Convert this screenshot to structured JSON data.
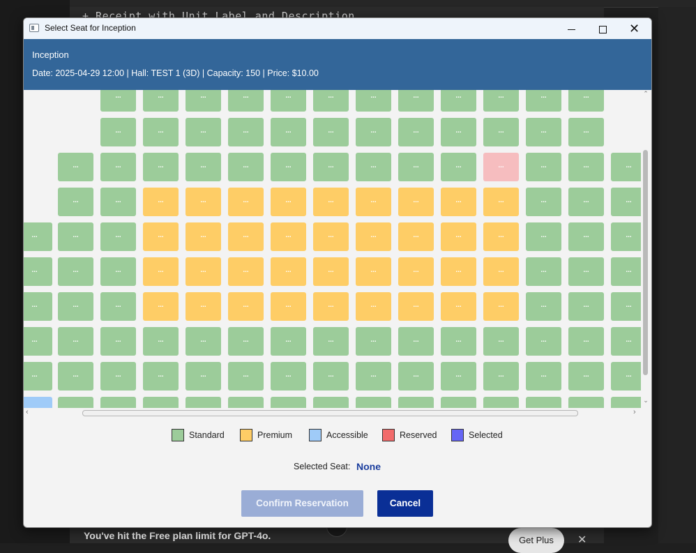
{
  "background": {
    "code_line": "+  Receipt  with  Unit  Label  and  Description",
    "limit_notice": "You've hit the Free plan limit for GPT-4o.",
    "upgrade_button": "Get Plus"
  },
  "window": {
    "title": "Select Seat for Inception",
    "minimize_icon": "minimize-icon",
    "maximize_icon": "maximize-icon",
    "close_icon": "close-icon"
  },
  "header": {
    "movie_title": "Inception",
    "info": "Date: 2025-04-29 12:00 | Hall: TEST 1 (3D) | Capacity: 150 | Price: $10.00"
  },
  "seat_map": {
    "seat_label": "...",
    "rows": [
      [
        "",
        "",
        "standard",
        "standard",
        "standard",
        "standard",
        "standard",
        "standard",
        "standard",
        "standard",
        "standard",
        "standard",
        "standard",
        "standard",
        ""
      ],
      [
        "",
        "",
        "standard",
        "standard",
        "standard",
        "standard",
        "standard",
        "standard",
        "standard",
        "standard",
        "standard",
        "standard",
        "standard",
        "standard",
        ""
      ],
      [
        "",
        "standard",
        "standard",
        "standard",
        "standard",
        "standard",
        "standard",
        "standard",
        "standard",
        "standard",
        "standard",
        "reserved",
        "standard",
        "standard",
        "standard"
      ],
      [
        "",
        "standard",
        "standard",
        "premium",
        "premium",
        "premium",
        "premium",
        "premium",
        "premium",
        "premium",
        "premium",
        "premium",
        "standard",
        "standard",
        "standard"
      ],
      [
        "standard",
        "standard",
        "standard",
        "premium",
        "premium",
        "premium",
        "premium",
        "premium",
        "premium",
        "premium",
        "premium",
        "premium",
        "standard",
        "standard",
        "standard"
      ],
      [
        "standard",
        "standard",
        "standard",
        "premium",
        "premium",
        "premium",
        "premium",
        "premium",
        "premium",
        "premium",
        "premium",
        "premium",
        "standard",
        "standard",
        "standard"
      ],
      [
        "standard",
        "standard",
        "standard",
        "premium",
        "premium",
        "premium",
        "premium",
        "premium",
        "premium",
        "premium",
        "premium",
        "premium",
        "standard",
        "standard",
        "standard"
      ],
      [
        "standard",
        "standard",
        "standard",
        "standard",
        "standard",
        "standard",
        "standard",
        "standard",
        "standard",
        "standard",
        "standard",
        "standard",
        "standard",
        "standard",
        "standard"
      ],
      [
        "standard",
        "standard",
        "standard",
        "standard",
        "standard",
        "standard",
        "standard",
        "standard",
        "standard",
        "standard",
        "standard",
        "standard",
        "standard",
        "standard",
        "standard"
      ],
      [
        "accessible",
        "standard",
        "standard",
        "standard",
        "standard",
        "standard",
        "standard",
        "standard",
        "standard",
        "standard",
        "standard",
        "standard",
        "standard",
        "standard",
        "standard"
      ]
    ]
  },
  "legend": [
    {
      "label": "Standard",
      "color": "#9ccc9a"
    },
    {
      "label": "Premium",
      "color": "#fecd66"
    },
    {
      "label": "Accessible",
      "color": "#9fcbf8"
    },
    {
      "label": "Reserved",
      "color": "#f26b6b"
    },
    {
      "label": "Selected",
      "color": "#6666f5"
    }
  ],
  "selection": {
    "label": "Selected Seat:",
    "value": "None"
  },
  "buttons": {
    "confirm": "Confirm Reservation",
    "cancel": "Cancel"
  }
}
